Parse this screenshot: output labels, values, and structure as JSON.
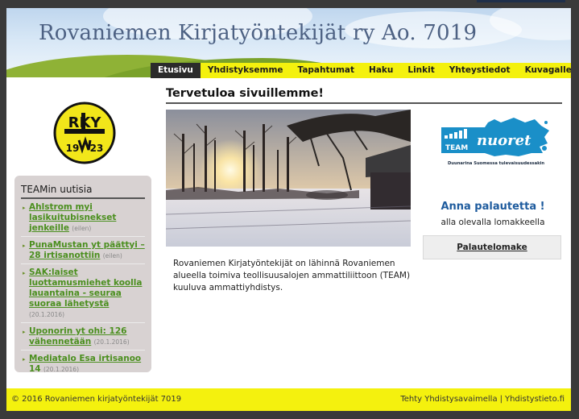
{
  "header": {
    "title": "Rovaniemen Kirjatyöntekijät ry Ao. 7019"
  },
  "nav": {
    "items": [
      "Etusivu",
      "Yhdistyksemme",
      "Tapahtumat",
      "Haku",
      "Linkit",
      "Yhteystiedot",
      "Kuvagalleria"
    ],
    "active": "Etusivu"
  },
  "logo": {
    "top_letters": "RKY",
    "year_left": "19",
    "year_right": "23"
  },
  "news": {
    "title": "TEAMin uutisia",
    "items": [
      {
        "title": "Ahlstrom myi lasikuitubisnekset jenkeille",
        "date": "(eilen)"
      },
      {
        "title": "PunaMustan yt päättyi – 28 irtisanottiin",
        "date": "(eilen)"
      },
      {
        "title": "SAK:laiset luottamusmiehet koolla lauantaina - seuraa suoraa lähetystä",
        "date": "(20.1.2016)"
      },
      {
        "title": "Uponorin yt ohi: 126 vähennetään",
        "date": "(20.1.2016)"
      },
      {
        "title": "Mediatalo Esa irtisanoo 14",
        "date": "(20.1.2016)"
      }
    ]
  },
  "main": {
    "welcome": "Tervetuloa sivuillemme!",
    "intro": "Rovaniemen Kirjatyöntekijät on lähinnä Rovaniemen alueella toimiva teollisuusalojen ammattiliittoon (TEAM) kuuluva ammattiyhdistys."
  },
  "sidebar_right": {
    "team_logo": {
      "team": "TEAM",
      "nuoret": "nuoret",
      "slogan": "Duunarina Suomessa tulevaisuudessakin"
    },
    "feedback_title": "Anna palautetta !",
    "feedback_sub": "alla olevalla lomakkeella",
    "feedback_button": "Palautelomake"
  },
  "footer": {
    "copyright": "© 2016 Rovaniemen kirjatyöntekijät  7019",
    "made_with": "Tehty Yhdistysavaimella",
    "separator": "|",
    "site": "Yhdistystieto.fi"
  },
  "colors": {
    "nav_yellow": "#f4f10e",
    "link_green": "#4b8f1f",
    "title_blue": "#4d6183",
    "feedback_blue": "#1f5c9e",
    "team_blue": "#1a8fc8"
  }
}
